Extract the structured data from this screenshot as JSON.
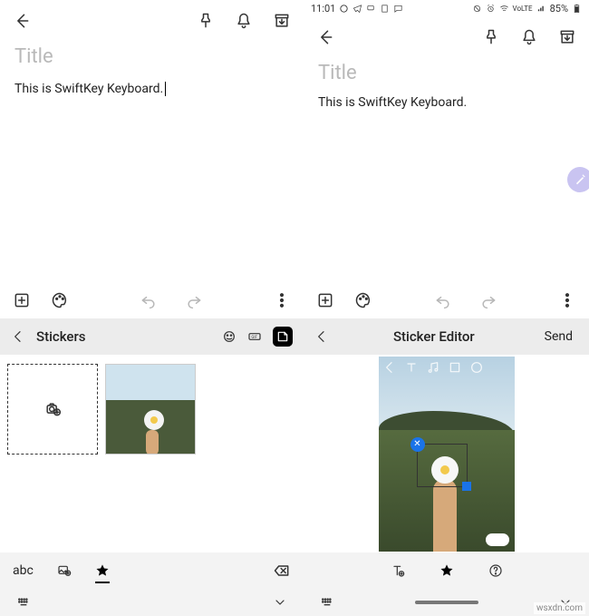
{
  "left": {
    "title_placeholder": "Title",
    "body_text": "This is SwiftKey Keyboard.",
    "kb_header": "Stickers",
    "abc_label": "abc"
  },
  "right": {
    "status_time": "11:01",
    "battery_text": "85%",
    "title_placeholder": "Title",
    "body_text": "This is SwiftKey Keyboard.",
    "kb_header": "Sticker Editor",
    "send_label": "Send"
  },
  "watermark": "wsxdn.com"
}
